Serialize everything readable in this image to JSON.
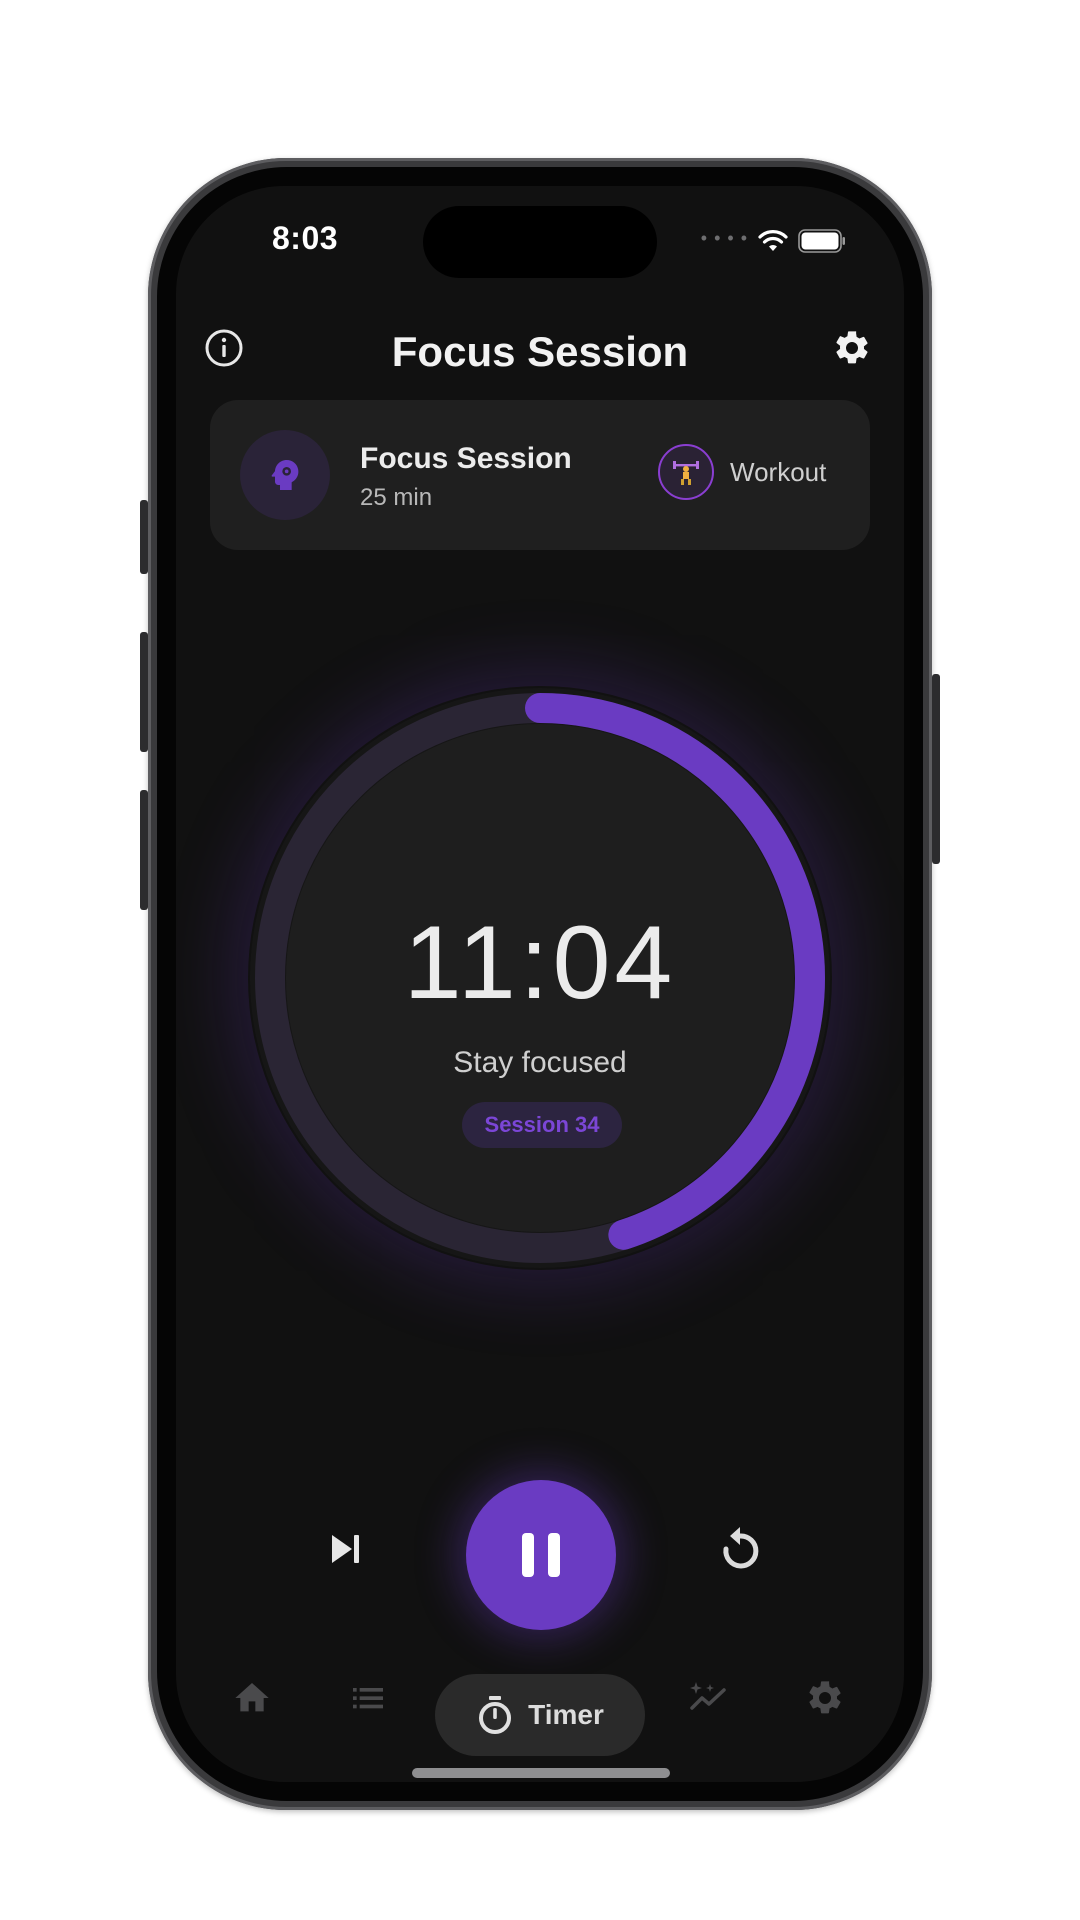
{
  "status_bar": {
    "time": "8:03",
    "icons": [
      "cellular-signal-icon",
      "wifi-icon",
      "battery-icon"
    ]
  },
  "header": {
    "title": "Focus Session",
    "left_icon": "info-icon",
    "right_icon": "gear-icon"
  },
  "session_card": {
    "title": "Focus Session",
    "duration": "25 min",
    "icon": "brain-gear-icon",
    "secondary_label": "Workout",
    "secondary_icon": "weightlifter-icon"
  },
  "timer": {
    "time_remaining": "11:04",
    "message": "Stay focused",
    "session_label": "Session 34",
    "progress_fraction": 0.45
  },
  "controls": {
    "skip_icon": "skip-next-icon",
    "pause_icon": "pause-icon",
    "reset_icon": "reset-icon"
  },
  "tab_bar": {
    "items": [
      {
        "icon": "home-icon",
        "label": ""
      },
      {
        "icon": "list-icon",
        "label": ""
      },
      {
        "icon": "stopwatch-icon",
        "label": "Timer",
        "active": true
      },
      {
        "icon": "sparkle-chart-icon",
        "label": ""
      },
      {
        "icon": "gear-icon",
        "label": ""
      }
    ]
  },
  "colors": {
    "accent": "#6a3bc2",
    "ring_progress": "#6a3bc2",
    "background": "#111111",
    "card": "#1f1f1f"
  }
}
